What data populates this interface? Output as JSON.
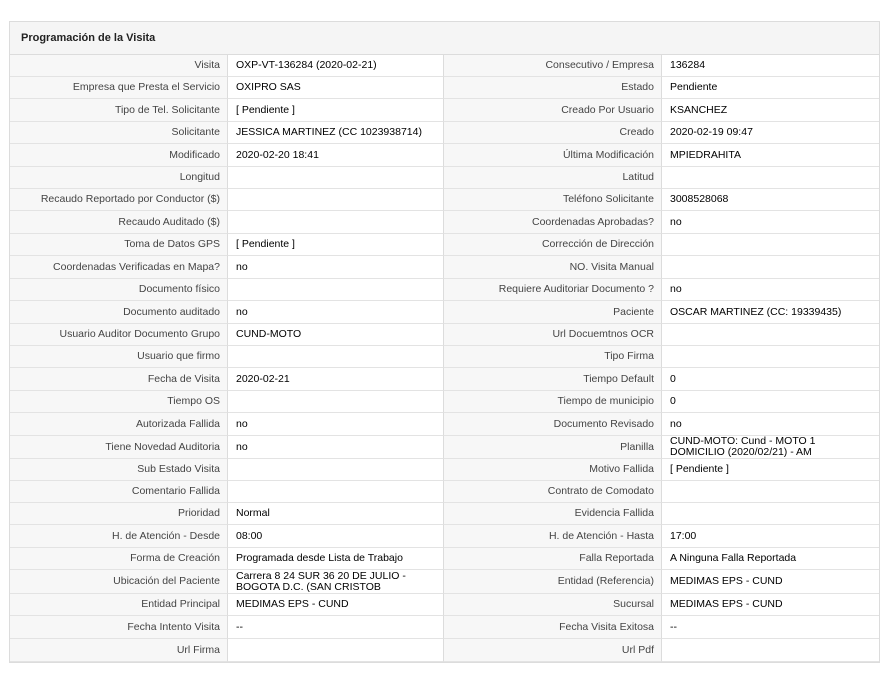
{
  "panel": {
    "title": "Programación de la Visita"
  },
  "rows": [
    {
      "l1": "Visita",
      "v1": "OXP-VT-136284 (2020-02-21)",
      "l2": "Consecutivo / Empresa",
      "v2": "136284"
    },
    {
      "l1": "Empresa que Presta el Servicio",
      "v1": "OXIPRO SAS",
      "l2": "Estado",
      "v2": "Pendiente"
    },
    {
      "l1": "Tipo de Tel. Solicitante",
      "v1": "[ Pendiente ]",
      "l2": "Creado Por Usuario",
      "v2": "KSANCHEZ"
    },
    {
      "l1": "Solicitante",
      "v1": "JESSICA MARTINEZ (CC 1023938714)",
      "l2": "Creado",
      "v2": "2020-02-19 09:47"
    },
    {
      "l1": "Modificado",
      "v1": "2020-02-20 18:41",
      "l2": "Última Modificación",
      "v2": " MPIEDRAHITA"
    },
    {
      "l1": "Longitud",
      "v1": "",
      "l2": "Latitud",
      "v2": ""
    },
    {
      "l1": "Recaudo Reportado por Conductor ($)",
      "v1": "",
      "l2": "Teléfono Solicitante",
      "v2": "3008528068"
    },
    {
      "l1": "Recaudo Auditado ($)",
      "v1": "",
      "l2": "Coordenadas Aprobadas?",
      "v2": " no"
    },
    {
      "l1": "Toma de Datos GPS",
      "v1": "[ Pendiente ]",
      "l2": "Corrección de Dirección",
      "v2": ""
    },
    {
      "l1": "Coordenadas Verificadas en Mapa?",
      "v1": " no",
      "l2": "NO. Visita Manual",
      "v2": ""
    },
    {
      "l1": "Documento físico",
      "v1": "",
      "l2": "Requiere Auditoriar Documento ?",
      "v2": " no"
    },
    {
      "l1": "Documento auditado",
      "v1": " no",
      "l2": "Paciente",
      "v2": "OSCAR MARTINEZ (CC: 19339435)"
    },
    {
      "l1": "Usuario Auditor Documento Grupo",
      "v1": "CUND-MOTO",
      "l2": "Url Docuemtnos OCR",
      "v2": ""
    },
    {
      "l1": "Usuario que firmo",
      "v1": "",
      "l2": "Tipo Firma",
      "v2": ""
    },
    {
      "l1": "Fecha de Visita",
      "v1": " 2020-02-21",
      "l2": "Tiempo Default",
      "v2": "0"
    },
    {
      "l1": "Tiempo OS",
      "v1": "",
      "l2": "Tiempo de municipio",
      "v2": "0"
    },
    {
      "l1": "Autorizada Fallida",
      "v1": " no",
      "l2": "Documento Revisado",
      "v2": " no"
    },
    {
      "l1": "Tiene Novedad Auditoria",
      "v1": " no",
      "l2": "Planilla",
      "v2": "CUND-MOTO: Cund - MOTO 1 DOMICILIO (2020/02/21) - AM"
    },
    {
      "l1": "Sub Estado Visita",
      "v1": "",
      "l2": "Motivo Fallida",
      "v2": "[ Pendiente ]"
    },
    {
      "l1": "Comentario Fallida",
      "v1": "",
      "l2": "Contrato de Comodato",
      "v2": ""
    },
    {
      "l1": "Prioridad",
      "v1": "Normal",
      "l2": "Evidencia Fallida",
      "v2": ""
    },
    {
      "l1": "H. de Atención - Desde",
      "v1": "08:00",
      "l2": "H. de Atención - Hasta",
      "v2": "17:00"
    },
    {
      "l1": "Forma de Creación",
      "v1": "Programada desde Lista de Trabajo",
      "l2": "Falla Reportada",
      "v2": "A Ninguna Falla Reportada"
    },
    {
      "l1": "Ubicación del Paciente",
      "v1": "Carrera 8 24 SUR 36 20 DE JULIO - BOGOTA D.C. (SAN CRISTOB",
      "l2": "Entidad (Referencia)",
      "v2": "MEDIMAS EPS - CUND"
    },
    {
      "l1": "Entidad Principal",
      "v1": "MEDIMAS EPS - CUND",
      "l2": "Sucursal",
      "v2": "MEDIMAS EPS - CUND"
    },
    {
      "l1": "Fecha Intento Visita",
      "v1": "--",
      "l2": "Fecha Visita Exitosa",
      "v2": "--"
    },
    {
      "l1": "Url Firma",
      "v1": "",
      "l2": "Url Pdf",
      "v2": ""
    }
  ]
}
